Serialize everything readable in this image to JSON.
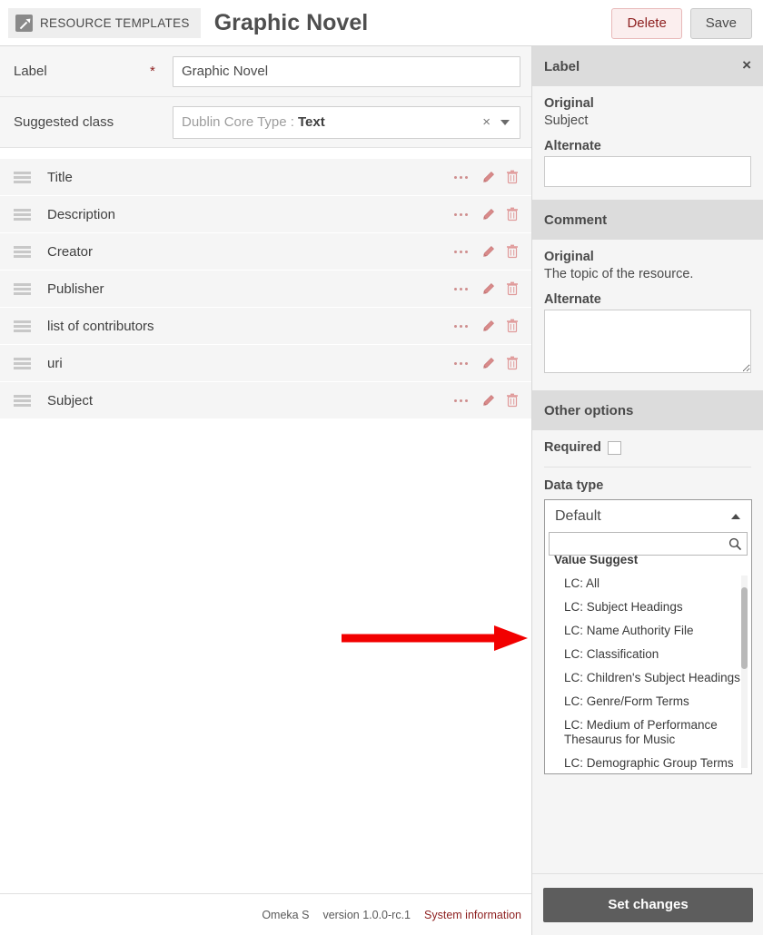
{
  "header": {
    "breadcrumb_icon": "pencil-square-icon",
    "breadcrumb_label": "RESOURCE TEMPLATES",
    "title": "Graphic Novel",
    "delete_label": "Delete",
    "save_label": "Save"
  },
  "form": {
    "label_field": {
      "label": "Label",
      "required_marker": "*",
      "value": "Graphic Novel"
    },
    "class_field": {
      "label": "Suggested class",
      "placeholder": "Dublin Core Type :",
      "value": "Text",
      "clear_icon": "×"
    }
  },
  "properties": [
    {
      "name": "Title"
    },
    {
      "name": "Description"
    },
    {
      "name": "Creator"
    },
    {
      "name": "Publisher"
    },
    {
      "name": "list of contributors"
    },
    {
      "name": "uri"
    },
    {
      "name": "Subject"
    }
  ],
  "footer": {
    "app": "Omeka S",
    "version": "version 1.0.0-rc.1",
    "system_information": "System information"
  },
  "sidebar": {
    "label_section": {
      "title": "Label",
      "close_icon": "×",
      "original_heading": "Original",
      "original_value": "Subject",
      "alternate_heading": "Alternate",
      "alternate_value": ""
    },
    "comment_section": {
      "title": "Comment",
      "original_heading": "Original",
      "original_value": "The topic of the resource.",
      "alternate_heading": "Alternate",
      "alternate_value": ""
    },
    "other_options": {
      "title": "Other options",
      "required_label": "Required",
      "required_checked": false,
      "data_type_label": "Data type",
      "data_type_selected": "Default",
      "search_value": "",
      "search_icon": "magnifier-icon",
      "options_group_label": "Value Suggest",
      "options": [
        "LC: All",
        "LC: Subject Headings",
        "LC: Name Authority File",
        "LC: Classification",
        "LC: Children's Subject Headings",
        "LC: Genre/Form Terms",
        "LC: Medium of Performance Thesaurus for Music",
        "LC: Demographic Group Terms"
      ]
    },
    "set_changes_label": "Set changes"
  },
  "annotation": {
    "arrow_color": "#f20000"
  },
  "colors": {
    "accent_red": "#8d1f1f",
    "icon_pink": "#cf8e8e",
    "panel_header_gray": "#dcdcdc",
    "button_dark": "#5d5d5d"
  }
}
